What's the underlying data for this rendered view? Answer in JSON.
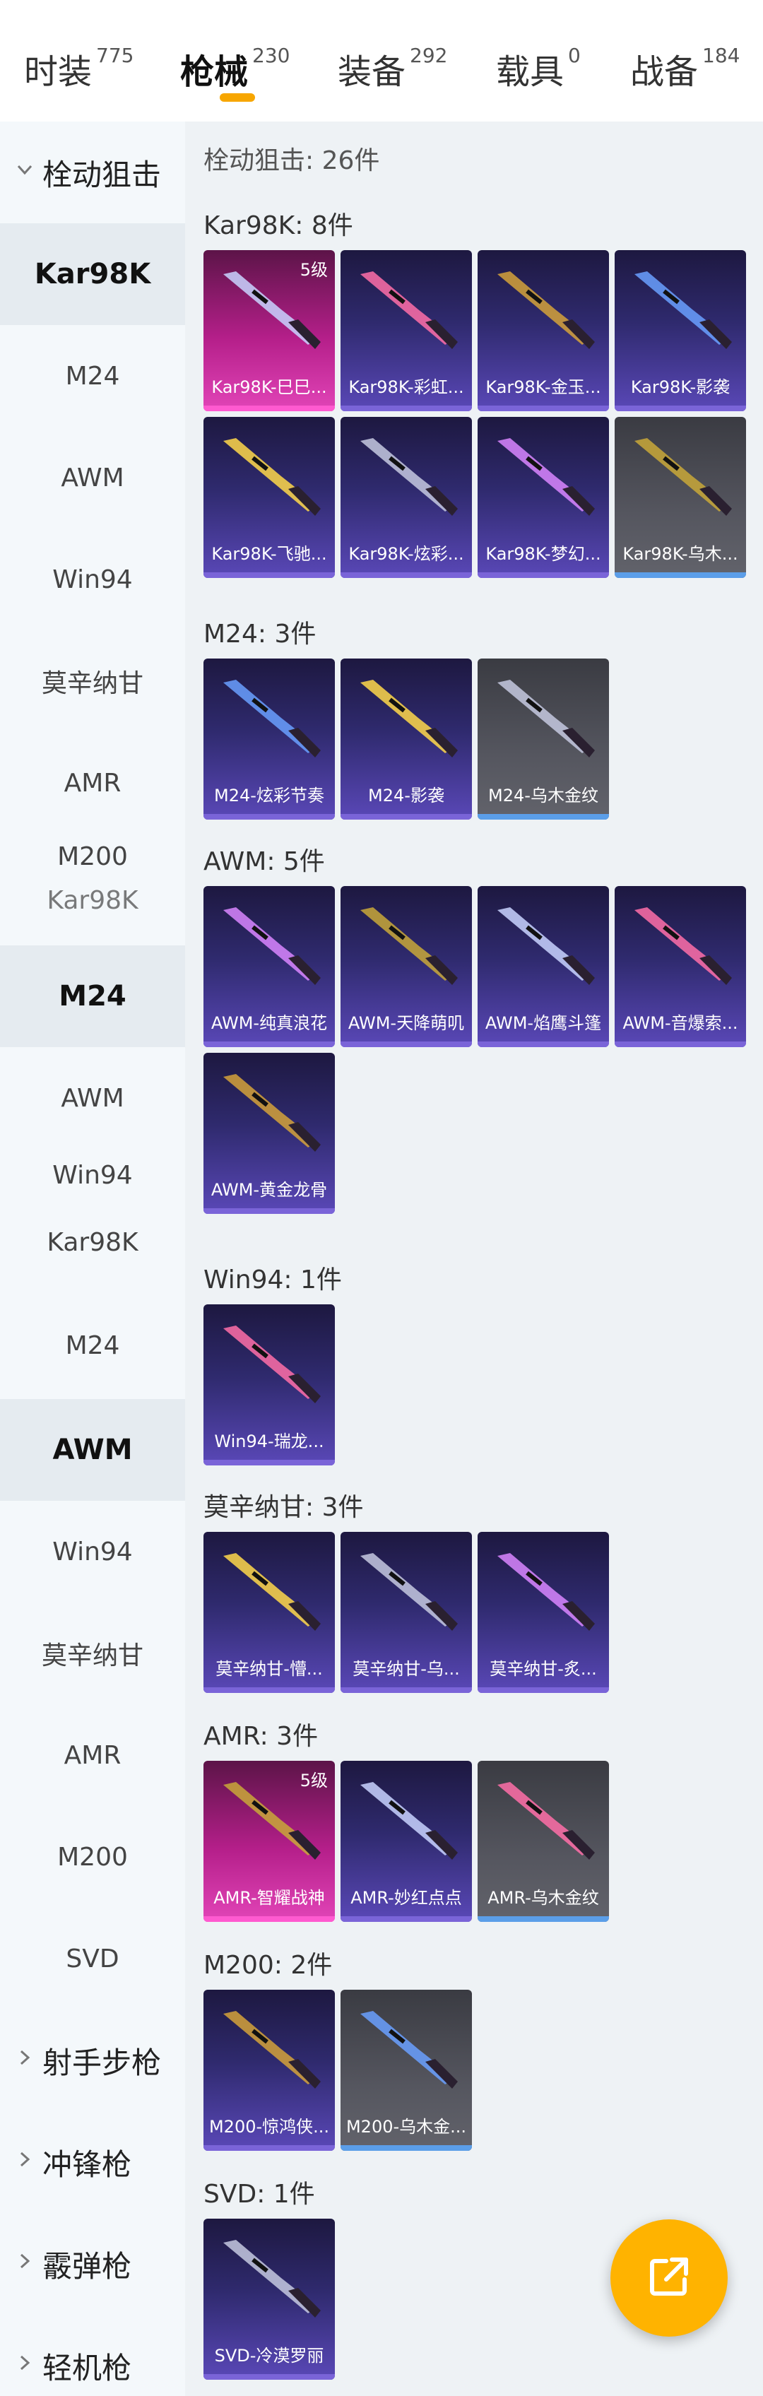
{
  "tabs": [
    {
      "label": "时装",
      "count": "775"
    },
    {
      "label": "枪械",
      "count": "230"
    },
    {
      "label": "装备",
      "count": "292"
    },
    {
      "label": "载具",
      "count": "0"
    },
    {
      "label": "战备",
      "count": "184"
    }
  ],
  "sidebar": {
    "category_open": "栓动狙击",
    "items": [
      "Kar98K",
      "M24",
      "AWM",
      "Win94",
      "莫辛纳甘",
      "AMR",
      "M200",
      "M24",
      "AWM",
      "Win94",
      "M24",
      "AWM",
      "Win94",
      "莫辛纳甘",
      "AMR",
      "M200",
      "SVD"
    ],
    "ghosts": [
      "Kar98K",
      "Kar98K"
    ],
    "categories": [
      "射手步枪",
      "冲锋枪",
      "霰弹枪",
      "轻机枪"
    ]
  },
  "main": {
    "category_title": "栓动狙击: 26件",
    "sections": [
      {
        "title": "Kar98K: 8件",
        "cards": [
          {
            "name": "Kar98K-巳巳...",
            "style": "pink",
            "level": "5级"
          },
          {
            "name": "Kar98K-彩虹...",
            "style": "purple"
          },
          {
            "name": "Kar98K-金玉...",
            "style": "purple"
          },
          {
            "name": "Kar98K-影袭",
            "style": "purple"
          },
          {
            "name": "Kar98K-飞驰...",
            "style": "purple"
          },
          {
            "name": "Kar98K-炫彩...",
            "style": "purple"
          },
          {
            "name": "Kar98K-梦幻...",
            "style": "purple"
          },
          {
            "name": "Kar98K-乌木...",
            "style": "grey"
          }
        ]
      },
      {
        "title": "M24: 3件",
        "cards": [
          {
            "name": "M24-炫彩节奏",
            "style": "purple"
          },
          {
            "name": "M24-影袭",
            "style": "purple"
          },
          {
            "name": "M24-乌木金纹",
            "style": "grey"
          }
        ]
      },
      {
        "title": "AWM: 5件",
        "cards": [
          {
            "name": "AWM-纯真浪花",
            "style": "purple"
          },
          {
            "name": "AWM-天降萌叽",
            "style": "purple"
          },
          {
            "name": "AWM-焰鹰斗篷",
            "style": "purple"
          },
          {
            "name": "AWM-音爆索...",
            "style": "purple"
          },
          {
            "name": "AWM-黄金龙骨",
            "style": "purple"
          }
        ]
      },
      {
        "title": "Win94: 1件",
        "cards": [
          {
            "name": "Win94-瑞龙...",
            "style": "purple"
          }
        ]
      },
      {
        "title": "莫辛纳甘: 3件",
        "cards": [
          {
            "name": "莫辛纳甘-懵...",
            "style": "purple"
          },
          {
            "name": "莫辛纳甘-乌...",
            "style": "purple"
          },
          {
            "name": "莫辛纳甘-炙...",
            "style": "purple"
          }
        ]
      },
      {
        "title": "AMR: 3件",
        "cards": [
          {
            "name": "AMR-智耀战神",
            "style": "pink",
            "level": "5级"
          },
          {
            "name": "AMR-妙红点点",
            "style": "purple"
          },
          {
            "name": "AMR-乌木金纹",
            "style": "grey"
          }
        ]
      },
      {
        "title": "M200: 2件",
        "cards": [
          {
            "name": "M200-惊鸿侠...",
            "style": "purple"
          },
          {
            "name": "M200-乌木金...",
            "style": "grey"
          }
        ]
      },
      {
        "title": "SVD: 1件",
        "cards": [
          {
            "name": "SVD-冷漠罗丽",
            "style": "purple"
          }
        ]
      }
    ]
  },
  "fab": {
    "icon": "share-external-icon"
  },
  "colors": {
    "accent": "#f7a600",
    "fab": "#ffb300",
    "sidebar_bg": "#f4f8fb",
    "main_bg": "#eef2f5"
  }
}
